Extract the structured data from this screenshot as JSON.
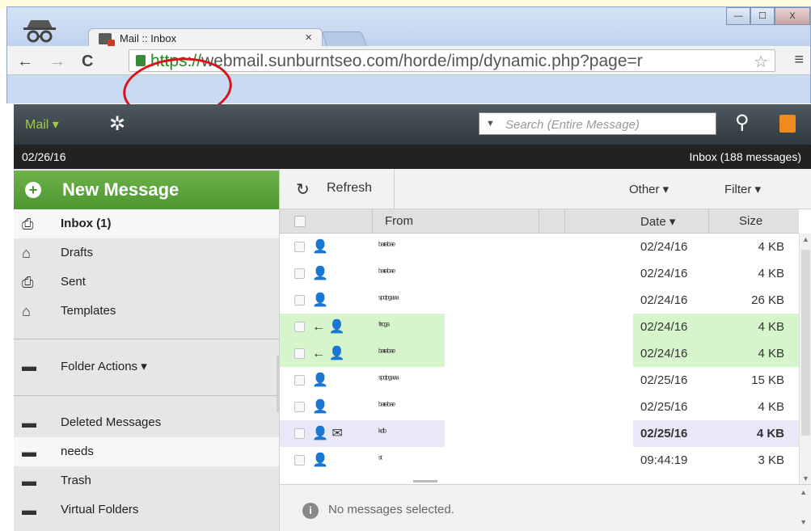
{
  "browser": {
    "tab_title": "Mail :: Inbox",
    "tab_close": "×",
    "url_scheme": "https://",
    "url_rest": "webmail.sunburntseo.com/horde/imp/dynamic.php?page=r",
    "back": "←",
    "forward": "→",
    "reload": "C",
    "star": "☆",
    "menu": "≡",
    "win_min": "—",
    "win_max": "☐",
    "win_close": "X"
  },
  "header": {
    "mail_menu": "Mail ▾",
    "gear": "✲",
    "search_caret": "▼",
    "search_placeholder": "Search (Entire Message)",
    "search_icon": "⚲"
  },
  "datebar": {
    "date": "02/26/16",
    "inbox_count": "Inbox (188 messages)"
  },
  "sidebar": {
    "new_message": "New Message",
    "plus": "+",
    "items": [
      {
        "label": "Inbox (1)",
        "icon": "⎙"
      },
      {
        "label": "Drafts",
        "icon": "⌂"
      },
      {
        "label": "Sent",
        "icon": "⎙"
      },
      {
        "label": "Templates",
        "icon": "⌂"
      },
      {
        "label": "Folder Actions ▾",
        "icon": "▬"
      },
      {
        "label": "Deleted Messages",
        "icon": "▬"
      },
      {
        "label": "needs",
        "icon": "▬"
      },
      {
        "label": "Trash",
        "icon": "▬"
      },
      {
        "label": "Virtual Folders",
        "icon": "▬"
      }
    ]
  },
  "toolbar": {
    "refresh_icon": "↻",
    "refresh": "Refresh",
    "other": "Other ▾",
    "filter": "Filter ▾"
  },
  "table": {
    "col_from": "From",
    "col_date": "Date ▾",
    "col_size": "Size",
    "rows": [
      {
        "icons": "👤",
        "from": "ᵇᵃᶦᶦᵃᵇᵃᵉ",
        "date": "02/24/16",
        "size": "4 KB"
      },
      {
        "icons": "👤",
        "from": "ᵇᵃᶦᶦᵃᵇᵃᵉ",
        "date": "02/24/16",
        "size": "4 KB"
      },
      {
        "icons": "👤",
        "from": "ˢᵖᵈᵖᵍᵃᵃᵃ",
        "date": "02/24/16",
        "size": "26 KB"
      },
      {
        "icons": "← 👤",
        "from": "ᶠʳᶦᶜᵍᵃ",
        "date": "02/24/16",
        "size": "4 KB"
      },
      {
        "icons": "← 👤",
        "from": "ᵇᵃᶦᶦᵃᵇᵃᵉ",
        "date": "02/24/16",
        "size": "4 KB"
      },
      {
        "icons": "👤",
        "from": "ˢᵖᵈᵖᵍᵃᵃᵃ",
        "date": "02/25/16",
        "size": "15 KB"
      },
      {
        "icons": "👤",
        "from": "ᵇᵃᶦᶦᵃᵇᵃᵉ",
        "date": "02/25/16",
        "size": "4 KB"
      },
      {
        "icons": "👤 ✉",
        "from": "ᵏᵈᵇ",
        "date": "02/25/16",
        "size": "4 KB"
      },
      {
        "icons": "👤",
        "from": "ˢᵗ",
        "date": "09:44:19",
        "size": "3 KB"
      }
    ]
  },
  "preview": {
    "info": "i",
    "text": "No messages selected."
  },
  "colors": {
    "accent_green": "#4c9630",
    "reply_highlight": "#d6f5cc",
    "unread_highlight": "#e8e8f8",
    "annotation_red": "#d8141a"
  }
}
